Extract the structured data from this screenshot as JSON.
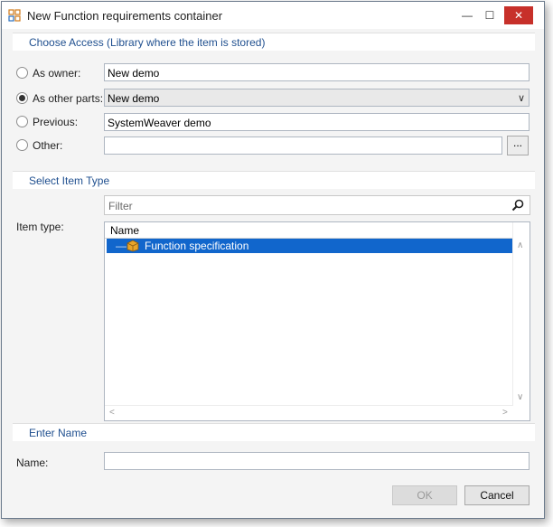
{
  "window": {
    "title": "New Function requirements container",
    "minimize": "—",
    "maximize": "☐",
    "close": "✕"
  },
  "access": {
    "heading": "Choose Access (Library where the item is stored)",
    "owner": {
      "label": "As owner:",
      "value": "New demo",
      "checked": false
    },
    "other_parts": {
      "label": "As other parts:",
      "value": "New demo",
      "checked": true
    },
    "previous": {
      "label": "Previous:",
      "value": "SystemWeaver demo",
      "checked": false
    },
    "other": {
      "label": "Other:",
      "value": "",
      "checked": false,
      "browse_label": "..."
    }
  },
  "item_type": {
    "heading": "Select Item Type",
    "filter_placeholder": "Filter",
    "field_label": "Item type:",
    "column_name": "Name",
    "rows": [
      {
        "label": "Function specification",
        "selected": true
      }
    ]
  },
  "name": {
    "heading": "Enter Name",
    "field_label": "Name:",
    "value": ""
  },
  "buttons": {
    "ok": "OK",
    "cancel": "Cancel"
  },
  "colors": {
    "accent": "#1f4f8f",
    "selection": "#1166cc",
    "close": "#c7302a"
  }
}
